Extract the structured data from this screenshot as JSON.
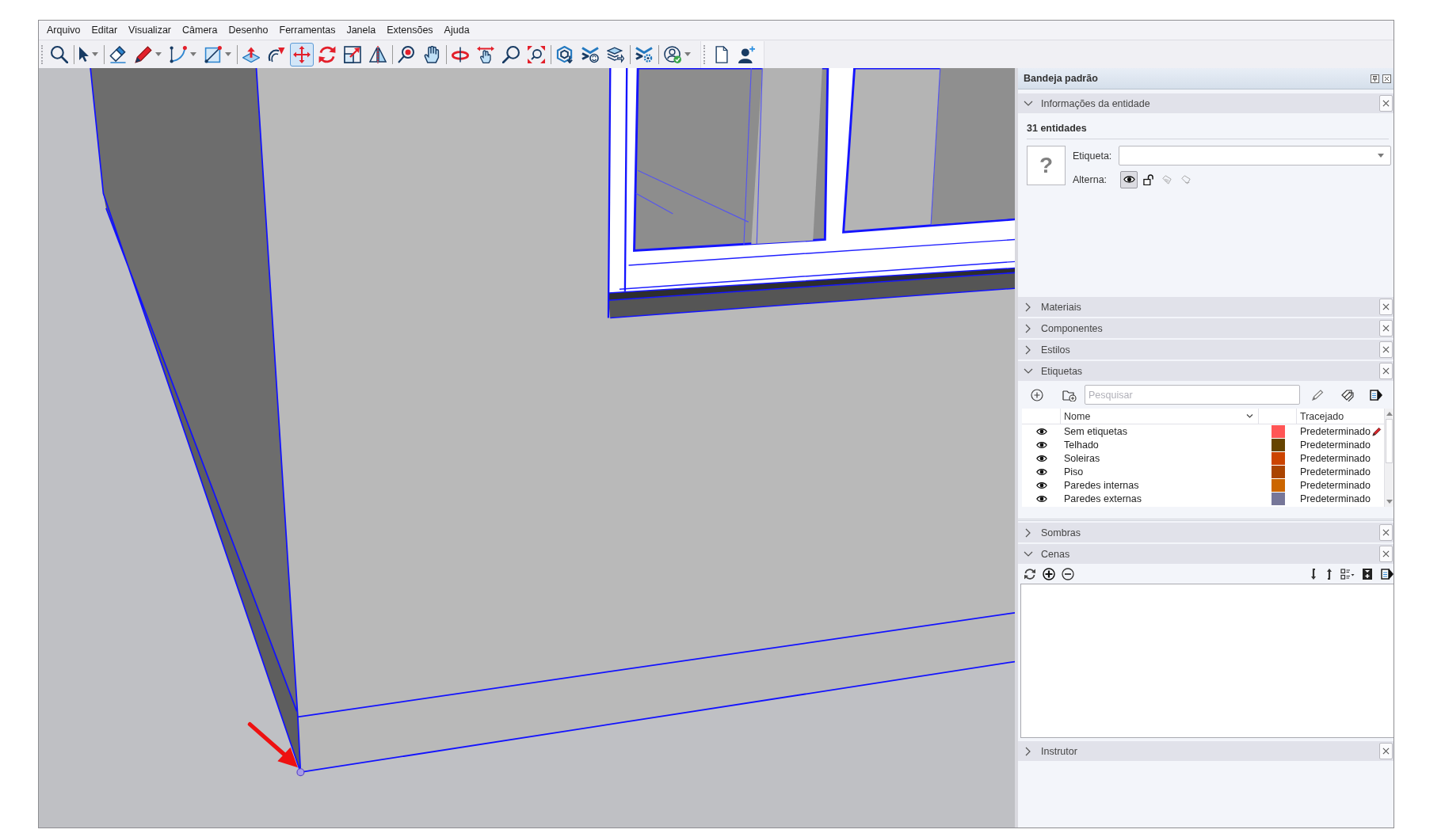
{
  "menu": [
    "Arquivo",
    "Editar",
    "Visualizar",
    "Câmera",
    "Desenho",
    "Ferramentas",
    "Janela",
    "Extensões",
    "Ajuda"
  ],
  "toolbars": [
    {
      "groups": [
        {
          "tools": [
            {
              "kind": "search",
              "selected": false,
              "dropdown": false
            }
          ]
        },
        {
          "tools": [
            {
              "kind": "select",
              "selected": false,
              "dropdown": true
            }
          ]
        },
        {
          "tools": [
            {
              "kind": "eraser",
              "selected": false,
              "dropdown": false
            },
            {
              "kind": "pencil",
              "selected": false,
              "dropdown": true
            },
            {
              "kind": "arc",
              "selected": false,
              "dropdown": true
            },
            {
              "kind": "rectangle",
              "selected": false,
              "dropdown": true
            }
          ]
        },
        {
          "tools": [
            {
              "kind": "pushpull",
              "selected": false,
              "dropdown": false
            },
            {
              "kind": "followme",
              "selected": false,
              "dropdown": false
            },
            {
              "kind": "move",
              "selected": true,
              "dropdown": false
            },
            {
              "kind": "rotate",
              "selected": false,
              "dropdown": false
            },
            {
              "kind": "scale",
              "selected": false,
              "dropdown": false
            },
            {
              "kind": "flip",
              "selected": false,
              "dropdown": false
            }
          ]
        },
        {
          "tools": [
            {
              "kind": "pin",
              "selected": false,
              "dropdown": false
            },
            {
              "kind": "hand",
              "selected": false,
              "dropdown": false
            }
          ]
        },
        {
          "tools": [
            {
              "kind": "orbit",
              "selected": false,
              "dropdown": false
            },
            {
              "kind": "pan",
              "selected": false,
              "dropdown": false
            },
            {
              "kind": "zoom",
              "selected": false,
              "dropdown": false
            },
            {
              "kind": "extents",
              "selected": false,
              "dropdown": false
            }
          ]
        },
        {
          "tools": [
            {
              "kind": "warehouse",
              "selected": false,
              "dropdown": false
            },
            {
              "kind": "extensions",
              "selected": false,
              "dropdown": false
            },
            {
              "kind": "layers",
              "selected": false,
              "dropdown": false
            }
          ]
        },
        {
          "tools": [
            {
              "kind": "gearstack",
              "selected": false,
              "dropdown": false
            }
          ]
        },
        {
          "tools": [
            {
              "kind": "account",
              "selected": false,
              "dropdown": true
            }
          ]
        }
      ]
    },
    {
      "groups": [
        {
          "tools": [
            {
              "kind": "document",
              "selected": false,
              "dropdown": false
            },
            {
              "kind": "adduser",
              "selected": false,
              "dropdown": false
            }
          ]
        }
      ]
    }
  ],
  "tray": {
    "title": "Bandeja padrão",
    "sections": [
      {
        "kind": "entity",
        "title": "Informações da entidade",
        "expanded": true,
        "summary": "31 entidades",
        "thumbnail": "?",
        "tag_label": "Etiqueta:",
        "toggle_label": "Alterna:",
        "toggles": [
          {
            "kind": "eye",
            "on": true,
            "disabled": false
          },
          {
            "kind": "lock",
            "on": false,
            "disabled": false
          },
          {
            "kind": "cast",
            "on": false,
            "disabled": true
          },
          {
            "kind": "receive",
            "on": false,
            "disabled": true
          }
        ]
      },
      {
        "title": "Materiais",
        "expanded": false
      },
      {
        "title": "Componentes",
        "expanded": false
      },
      {
        "title": "Estilos",
        "expanded": false
      },
      {
        "kind": "tags",
        "title": "Etiquetas",
        "expanded": true,
        "search": {
          "placeholder": "Pesquisar"
        },
        "columns": [
          {
            "label": "Nome",
            "sorted": true
          },
          {
            "label": "Tracejado",
            "sorted": false
          }
        ],
        "rows": [
          {
            "visible": true,
            "name": "Sem etiquetas",
            "color": "#ff5555",
            "dash": "Predeterminado",
            "current": true
          },
          {
            "visible": true,
            "name": "Telhado",
            "color": "#664400",
            "dash": "Predeterminado",
            "current": false
          },
          {
            "visible": true,
            "name": "Soleiras",
            "color": "#cc4400",
            "dash": "Predeterminado",
            "current": false
          },
          {
            "visible": true,
            "name": "Piso",
            "color": "#aa4400",
            "dash": "Predeterminado",
            "current": false
          },
          {
            "visible": true,
            "name": "Paredes internas",
            "color": "#cc6600",
            "dash": "Predeterminado",
            "current": false
          },
          {
            "visible": true,
            "name": "Paredes externas",
            "color": "#777799",
            "dash": "Predeterminado",
            "current": false
          }
        ]
      },
      {
        "title": "Sombras",
        "expanded": false
      },
      {
        "kind": "scenes",
        "title": "Cenas",
        "expanded": true
      },
      {
        "title": "Instrutor",
        "expanded": false
      }
    ]
  }
}
